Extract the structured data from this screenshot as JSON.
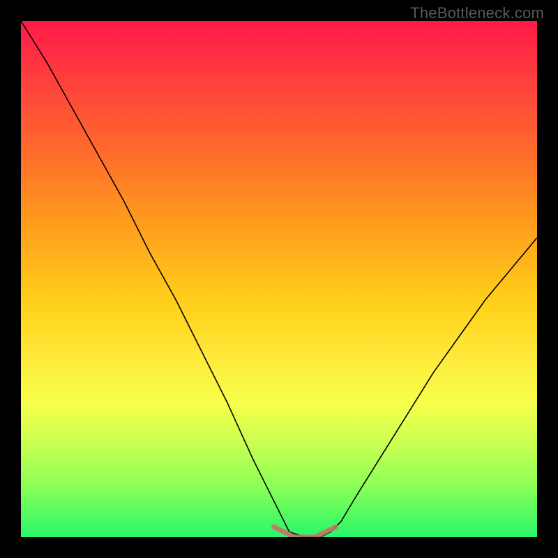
{
  "watermark": "TheBottleneck.com",
  "chart_data": {
    "type": "line",
    "title": "",
    "xlabel": "",
    "ylabel": "",
    "xlim": [
      0,
      100
    ],
    "ylim": [
      0,
      100
    ],
    "series": [
      {
        "name": "bottleneck-curve",
        "x": [
          0,
          5,
          10,
          15,
          20,
          25,
          30,
          35,
          40,
          45,
          50,
          52,
          55,
          58,
          60,
          62,
          65,
          70,
          75,
          80,
          85,
          90,
          95,
          100
        ],
        "values": [
          100,
          92,
          83,
          74,
          65,
          55,
          46,
          36,
          26,
          15,
          5,
          1,
          0,
          0,
          1,
          3,
          8,
          16,
          24,
          32,
          39,
          46,
          52,
          58
        ]
      },
      {
        "name": "trough-highlight",
        "x": [
          49,
          51,
          53,
          55,
          57,
          59,
          61
        ],
        "values": [
          2,
          1,
          0,
          0,
          0,
          1,
          2
        ]
      }
    ],
    "gradient_stops": [
      {
        "pos": 0,
        "color": "#ff1a49"
      },
      {
        "pos": 25,
        "color": "#ff6a2c"
      },
      {
        "pos": 55,
        "color": "#ffd11a"
      },
      {
        "pos": 82,
        "color": "#c9ff52"
      },
      {
        "pos": 100,
        "color": "#28f76a"
      }
    ]
  }
}
